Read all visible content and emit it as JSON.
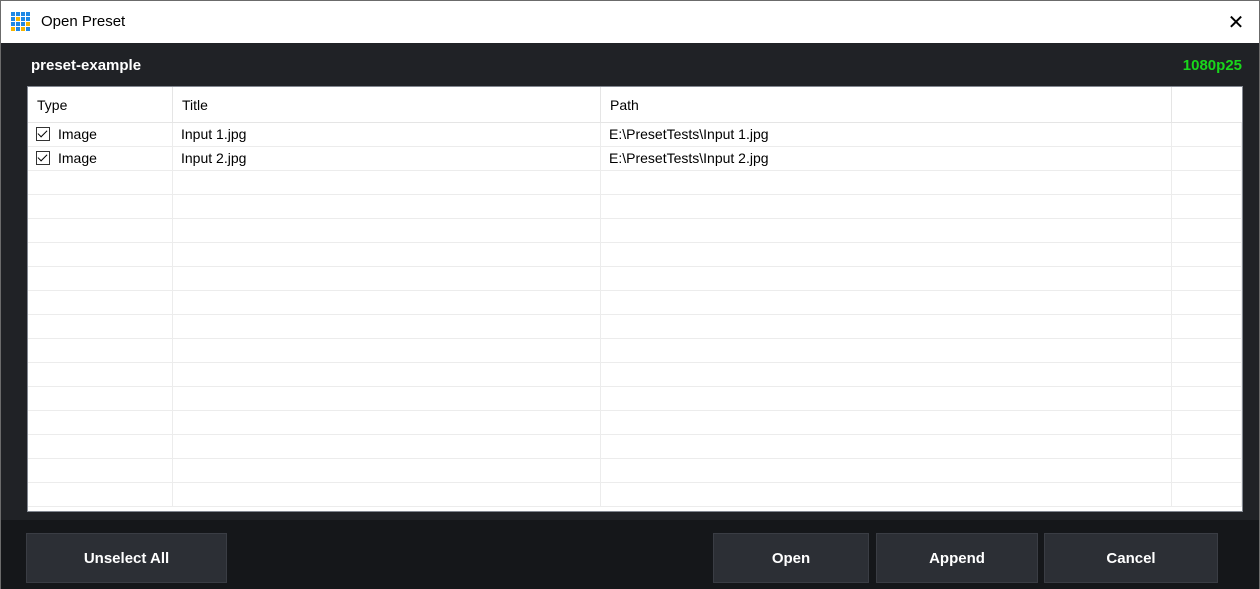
{
  "window": {
    "title": "Open Preset",
    "icon": "vmix-grid-icon"
  },
  "header": {
    "preset_name": "preset-example",
    "resolution": "1080p25",
    "resolution_color": "#19d61b"
  },
  "table": {
    "columns": [
      "Type",
      "Title",
      "Path"
    ],
    "rows": [
      {
        "checked": true,
        "type": "Image",
        "title": "Input 1.jpg",
        "path": "E:\\PresetTests\\Input 1.jpg"
      },
      {
        "checked": true,
        "type": "Image",
        "title": "Input 2.jpg",
        "path": "E:\\PresetTests\\Input 2.jpg"
      }
    ]
  },
  "buttons": {
    "unselect_all": "Unselect All",
    "open": "Open",
    "append": "Append",
    "cancel": "Cancel"
  }
}
